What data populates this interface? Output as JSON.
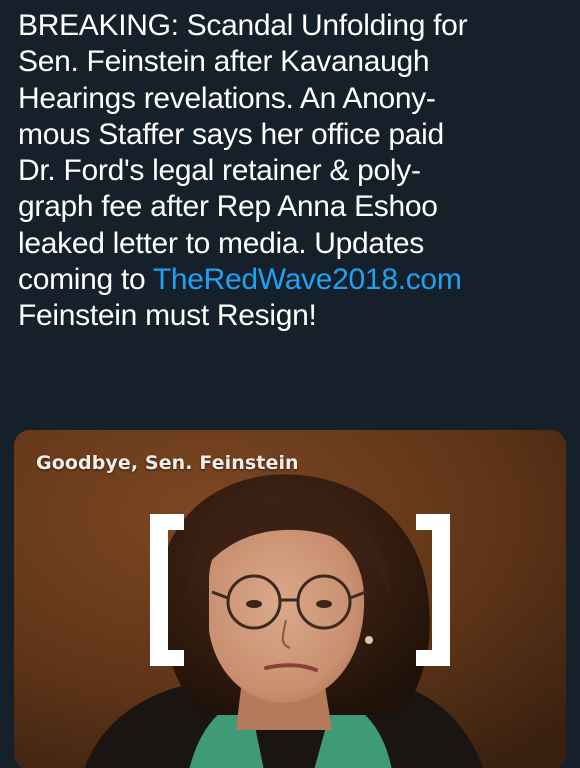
{
  "tweet": {
    "lines": [
      "BREAKING: Scandal Unfolding for",
      "Sen. Feinstein after Kavanaugh",
      "Hearings  revelations. An Anony-",
      "mous Staffer says her office paid",
      "Dr. Ford's legal  retainer & poly-",
      "graph fee after Rep Anna Eshoo",
      "leaked letter to media. Updates"
    ],
    "line8_prefix": "coming to ",
    "link_text": "TheRedWave2018.com",
    "line9": "Feinstein must Resign!"
  },
  "media": {
    "caption": "Goodbye, Sen. Feinstein",
    "link_color": "#1da1f2",
    "background_color": "#15202b"
  }
}
